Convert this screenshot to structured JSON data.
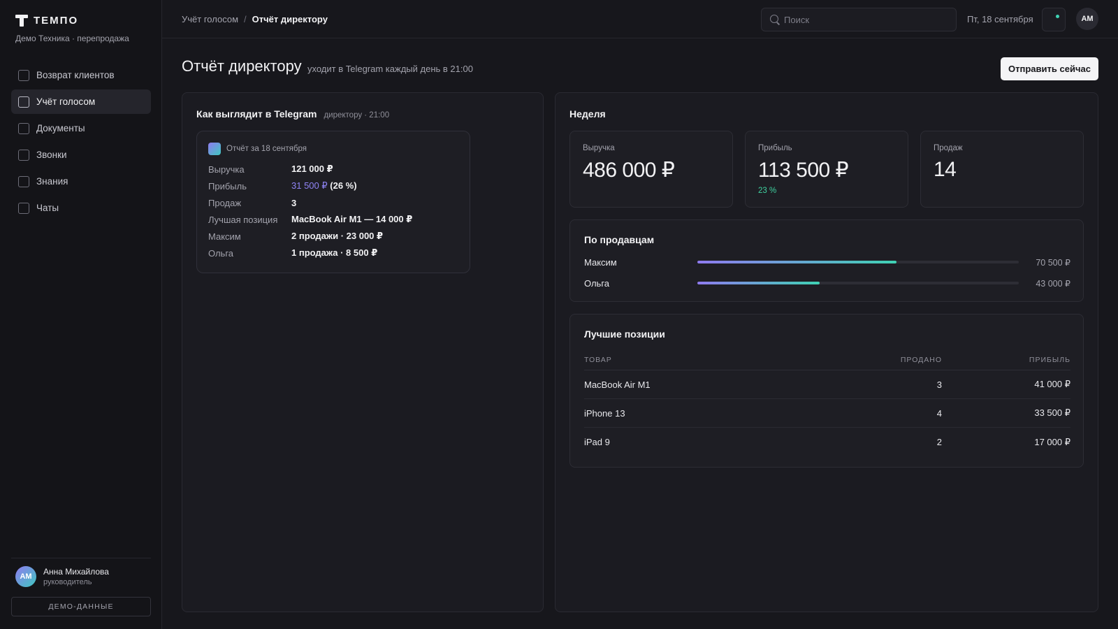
{
  "brand": {
    "name": "ТЕМПО",
    "subtitle": "Демо Техника · перепродажа"
  },
  "sidebar": {
    "items": [
      {
        "label": "Возврат клиентов",
        "active": false
      },
      {
        "label": "Учёт голосом",
        "active": true
      },
      {
        "label": "Документы",
        "active": false
      },
      {
        "label": "Звонки",
        "active": false
      },
      {
        "label": "Знания",
        "active": false
      },
      {
        "label": "Чаты",
        "active": false
      }
    ],
    "user": {
      "initials": "АМ",
      "name": "Анна Михайлова",
      "role": "руководитель"
    },
    "demo_label": "ДЕМО-ДАННЫЕ"
  },
  "topbar": {
    "breadcrumb": [
      "Учёт голосом",
      "Отчёт директору"
    ],
    "separator": "/",
    "search_placeholder": "Поиск",
    "date": "Пт, 18 сентября",
    "avatar_initials": "АМ"
  },
  "page": {
    "title": "Отчёт директору",
    "subtitle": "уходит в Telegram каждый день в 21:00",
    "send_button": "Отправить сейчас"
  },
  "preview": {
    "title": "Как выглядит в Telegram",
    "meta": "директору · 21:00",
    "card_title": "Отчёт за 18 сентября",
    "rows": [
      {
        "label": "Выручка",
        "value": "121 000 ₽"
      },
      {
        "label": "Прибыль",
        "accent": "31 500 ₽",
        "value": " (26 %)"
      },
      {
        "label": "Продаж",
        "value": "3"
      },
      {
        "label": "Лучшая позиция",
        "value": "MacBook Air M1 — 14 000 ₽"
      },
      {
        "label": "Максим",
        "value": "2 продажи · 23 000 ₽"
      },
      {
        "label": "Ольга",
        "value": "1 продажа · 8 500 ₽"
      }
    ]
  },
  "week": {
    "title": "Неделя",
    "kpis": [
      {
        "label": "Выручка",
        "value": "486 000 ₽",
        "note": ""
      },
      {
        "label": "Прибыль",
        "value": "113 500 ₽",
        "note": "23 %"
      },
      {
        "label": "Продаж",
        "value": "14",
        "note": ""
      }
    ],
    "sellers_title": "По продавцам",
    "sellers": [
      {
        "name": "Максим",
        "amount": "70 500 ₽",
        "share": 0.62
      },
      {
        "name": "Ольга",
        "amount": "43 000 ₽",
        "share": 0.38
      }
    ],
    "top_title": "Лучшие позиции",
    "top_columns": [
      "ТОВАР",
      "ПРОДАНО",
      "ПРИБЫЛЬ"
    ],
    "top_rows": [
      {
        "name": "MacBook Air M1",
        "sold": "3",
        "profit": "41 000 ₽"
      },
      {
        "name": "iPhone 13",
        "sold": "4",
        "profit": "33 500 ₽"
      },
      {
        "name": "iPad 9",
        "sold": "2",
        "profit": "17 000 ₽"
      }
    ]
  },
  "colors": {
    "accent_purple": "#8f7bf0",
    "accent_teal": "#3fd2b4",
    "positive": "#3fd2a0"
  }
}
